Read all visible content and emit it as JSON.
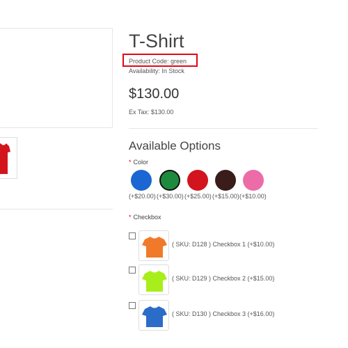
{
  "product": {
    "title": "T-Shirt",
    "code": "Product Code: green",
    "availability": "Availability: In Stock",
    "price": "$130.00",
    "ex_tax": "Ex Tax: $130.00"
  },
  "options": {
    "heading": "Available Options",
    "color": {
      "label": "Color",
      "swatches": [
        {
          "color": "#1b66d2",
          "price": "(+$20.00)",
          "selected": false
        },
        {
          "color": "#1e8a3e",
          "price": "(+$30.00)",
          "selected": true
        },
        {
          "color": "#d2141e",
          "price": "(+$25.00)",
          "selected": false
        },
        {
          "color": "#3a1c1a",
          "price": "(+$15.00)",
          "selected": false
        },
        {
          "color": "#ec6ca8",
          "price": "(+$10.00)",
          "selected": false
        }
      ]
    },
    "checkbox": {
      "label": "Checkbox",
      "items": [
        {
          "label": "( SKU: D128 ) Checkbox 1 (+$10.00)",
          "shirt_color": "#f07a2a"
        },
        {
          "label": "( SKU: D129 ) Checkbox 2 (+$15.00)",
          "shirt_color": "#a8ee1a"
        },
        {
          "label": "( SKU: D130 ) Checkbox 3 (+$16.00)",
          "shirt_color": "#2a6cc8"
        }
      ]
    }
  },
  "gallery": {
    "thumb_color": "#d4141c"
  },
  "colors": {
    "highlight": "#e30613",
    "required": "#e30613"
  }
}
